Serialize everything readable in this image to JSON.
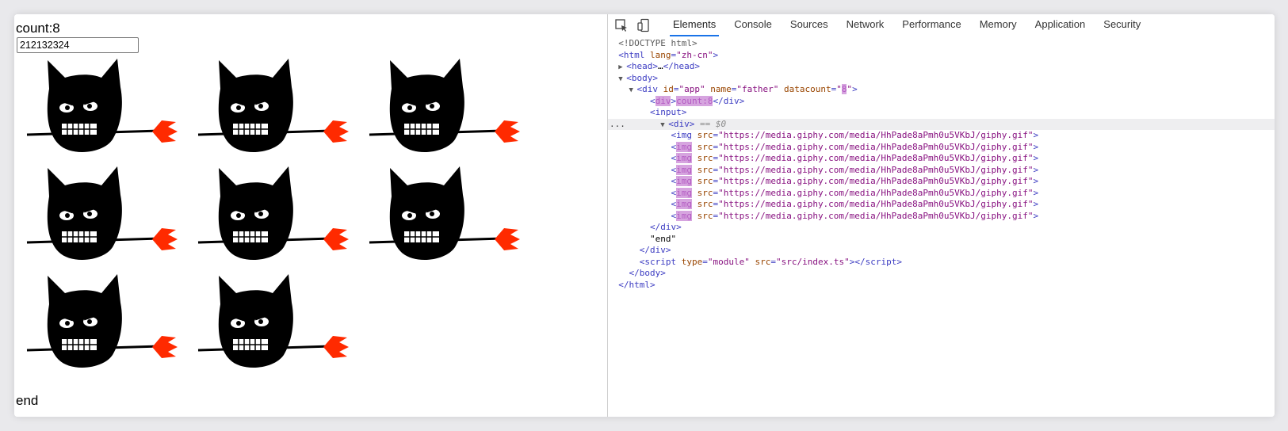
{
  "page": {
    "count_label": "count:8",
    "input_value": "212132324",
    "end_label": "end",
    "gif_count": 8
  },
  "devtools": {
    "tabs": [
      "Elements",
      "Console",
      "Sources",
      "Network",
      "Performance",
      "Memory",
      "Application",
      "Security"
    ],
    "active_tab": "Elements",
    "tree": {
      "doctype": "<!DOCTYPE html>",
      "html_open_tag": "html",
      "html_attr": "lang",
      "html_attr_val": "\"zh-cn\"",
      "head": "head",
      "head_ellipsis": "…",
      "body": "body",
      "div": "div",
      "div_id_attr": "id",
      "div_id_val": "\"app\"",
      "div_name_attr": "name",
      "div_name_val": "\"father\"",
      "div_datacount_attr": "datacount",
      "div_datacount_val_open": "\"",
      "div_datacount_val": "8",
      "div_datacount_val_close": "\"",
      "count_tag_hl": "div",
      "count_text_hl": "count:8",
      "input": "input",
      "inner_div": "div",
      "inner_div_marker": "== $0",
      "img_tag": "img",
      "img_attr": "src",
      "img_src": "\"https://media.giphy.com/media/HhPade8aPmh0u5VKbJ/giphy.gif\"",
      "end_text": "\"end\"",
      "script_tag": "script",
      "script_type_attr": "type",
      "script_type_val": "\"module\"",
      "script_src_attr": "src",
      "script_src_val": "\"src/index.ts\"",
      "ellipsis": "..."
    }
  },
  "colors": {
    "tag": "#881280",
    "attr_name": "#994500",
    "attr_value": "#1a1aa6",
    "highlight": "#d6a4df",
    "active_tab_underline": "#1a73e8",
    "cat_body": "#000000",
    "cat_fork": "#ff2a00"
  }
}
